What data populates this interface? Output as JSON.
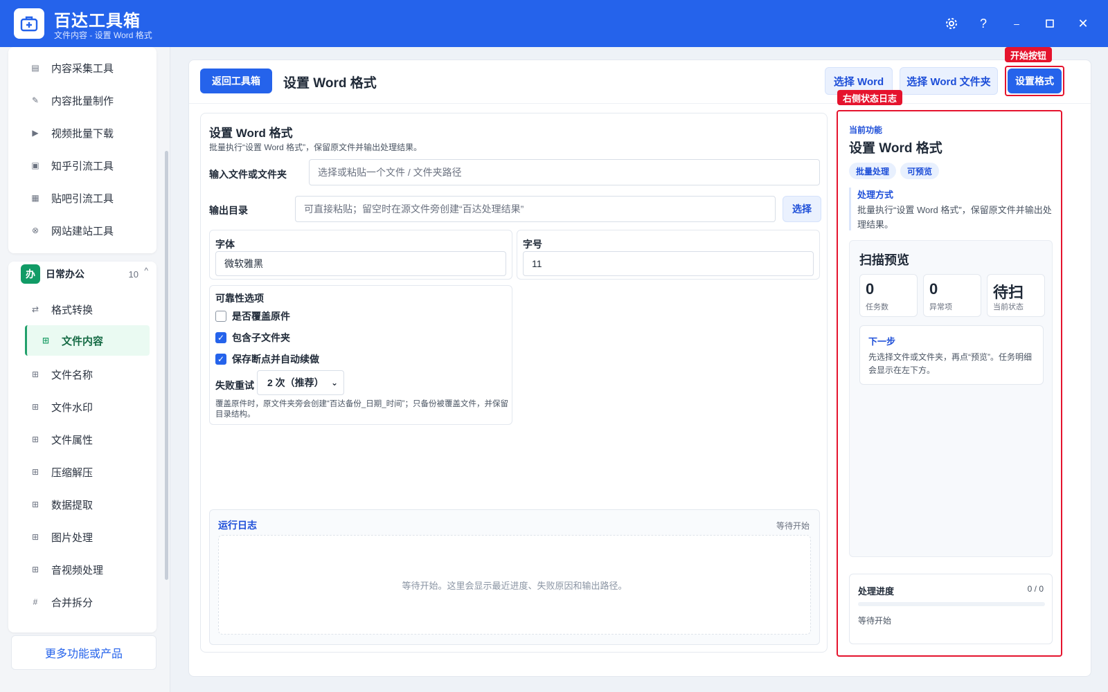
{
  "titlebar": {
    "title": "百达工具箱",
    "subtitle": "文件内容 - 设置 Word 格式",
    "accent": "#2563eb",
    "icons": [
      "toolbox-icon",
      "gear-icon",
      "help-icon",
      "minimize-icon",
      "maximize-icon",
      "close-icon"
    ]
  },
  "sidebar": {
    "top_items": [
      {
        "label": "内容采集工具",
        "icon": "collect-icon"
      },
      {
        "label": "内容批量制作",
        "icon": "pen-icon"
      },
      {
        "label": "视频批量下载",
        "icon": "video-icon"
      },
      {
        "label": "知乎引流工具",
        "icon": "zhihu-icon"
      },
      {
        "label": "贴吧引流工具",
        "icon": "tieba-icon"
      },
      {
        "label": "网站建站工具",
        "icon": "web-icon"
      }
    ],
    "group": {
      "badge": "办",
      "title": "日常办公",
      "count": "10",
      "caret": "^"
    },
    "group_items": [
      {
        "label": "格式转换",
        "icon": "swap-icon"
      },
      {
        "label": "文件内容",
        "icon": "grid-icon"
      },
      {
        "label": "文件名称",
        "icon": "grid-icon"
      },
      {
        "label": "文件水印",
        "icon": "grid-icon"
      },
      {
        "label": "文件属性",
        "icon": "grid-icon"
      },
      {
        "label": "压缩解压",
        "icon": "grid-icon"
      },
      {
        "label": "数据提取",
        "icon": "grid-icon"
      },
      {
        "label": "图片处理",
        "icon": "grid-icon"
      },
      {
        "label": "音视频处理",
        "icon": "grid-icon"
      },
      {
        "label": "合并拆分",
        "icon": "hash-icon"
      }
    ],
    "active_item": "文件内容",
    "more": "更多功能或产品"
  },
  "toolbar": {
    "back": "返回工具箱",
    "page_title": "设置 Word 格式",
    "select_word": "选择 Word",
    "select_folder": "选择 Word 文件夹",
    "start": "设置格式"
  },
  "form": {
    "title": "设置 Word 格式",
    "desc": "批量执行“设置 Word 格式”，保留原文件并输出处理结果。",
    "input_label": "输入文件或文件夹",
    "input_placeholder": "选择或粘贴一个文件 / 文件夹路径",
    "output_label": "输出目录",
    "output_placeholder": "可直接粘贴；留空时在源文件旁创建“百达处理结果”",
    "output_button": "选择",
    "font_label": "字体",
    "font_value": "微软雅黑",
    "size_label": "字号",
    "size_value": "11",
    "reliability_title": "可靠性选项",
    "options": [
      {
        "label": "是否覆盖原件",
        "checked": false
      },
      {
        "label": "包含子文件夹",
        "checked": true
      },
      {
        "label": "保存断点并自动续做",
        "checked": true
      }
    ],
    "retry_label": "失败重试",
    "retry_value": "2 次（推荐）",
    "note": "覆盖原件时，原文件夹旁会创建“百达备份_日期_时间”；只备份被覆盖文件，并保留目录结构。"
  },
  "log": {
    "title": "运行日志",
    "status": "等待开始",
    "placeholder": "等待开始。这里会显示最近进度、失败原因和输出路径。"
  },
  "right": {
    "current_label": "当前功能",
    "title": "设置 Word 格式",
    "tags": [
      "批量处理",
      "可预览"
    ],
    "method_title": "处理方式",
    "method_text": "批量执行“设置 Word 格式”，保留原文件并输出处理结果。",
    "scan_title": "扫描预览",
    "stats": [
      {
        "value": "0",
        "caption": "任务数"
      },
      {
        "value": "0",
        "caption": "异常项"
      },
      {
        "value": "待扫",
        "caption": "当前状态"
      }
    ],
    "next_title": "下一步",
    "next_text": "先选择文件或文件夹，再点“预览”。任务明细会显示在左下方。",
    "progress_title": "处理进度",
    "progress_count": "0 / 0",
    "progress_fraction": 0,
    "progress_status": "等待开始"
  },
  "annotations": {
    "start_button": "开始按钮",
    "right_log": "右侧状态日志",
    "color": "#e5132d"
  }
}
